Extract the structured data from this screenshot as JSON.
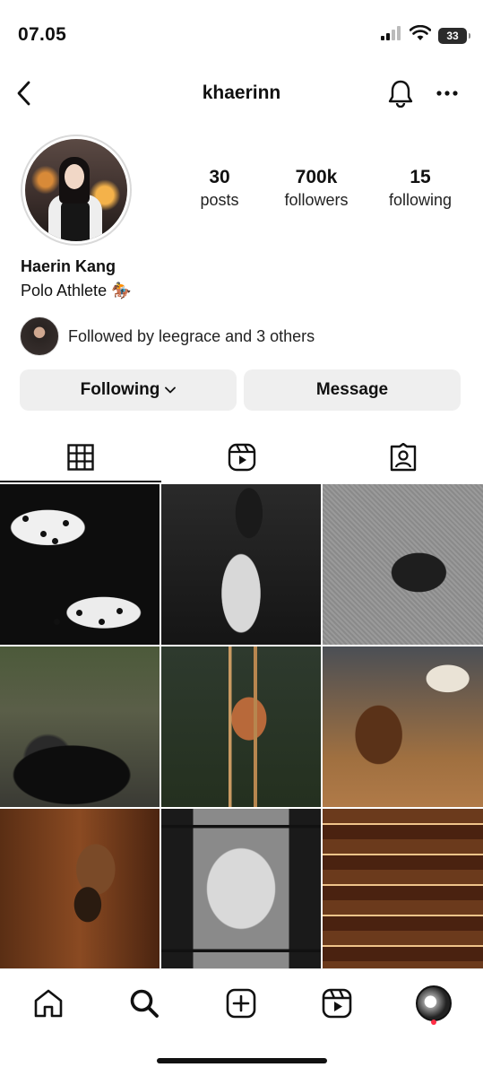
{
  "status_bar": {
    "time": "07.05",
    "battery": "33",
    "icons": [
      "cellular-signal-icon",
      "wifi-icon",
      "battery-icon"
    ]
  },
  "header": {
    "username": "khaerinn",
    "icons": [
      "back-arrow-icon",
      "bell-icon",
      "more-horizontal-icon"
    ]
  },
  "profile": {
    "stats": [
      {
        "value": "30",
        "label": "posts"
      },
      {
        "value": "700k",
        "label": "followers"
      },
      {
        "value": "15",
        "label": "following"
      }
    ],
    "display_name": "Haerin Kang",
    "bio": "Polo Athlete 🏇",
    "followed_by": "Followed by leegrace and 3 others"
  },
  "actions": {
    "following_label": "Following",
    "message_label": "Message"
  },
  "tabs": [
    {
      "name": "posts-grid",
      "icon": "grid-icon",
      "active": true
    },
    {
      "name": "reels",
      "icon": "reels-icon",
      "active": false
    },
    {
      "name": "tagged",
      "icon": "tagged-user-icon",
      "active": false
    }
  ],
  "posts_count_shown": 9,
  "bottom_nav": [
    "home-icon",
    "search-icon",
    "create-plus-icon",
    "reels-icon",
    "profile-avatar"
  ],
  "colors": {
    "button_bg": "#efefef",
    "text": "#111111",
    "notification_dot": "#ff2d45"
  }
}
